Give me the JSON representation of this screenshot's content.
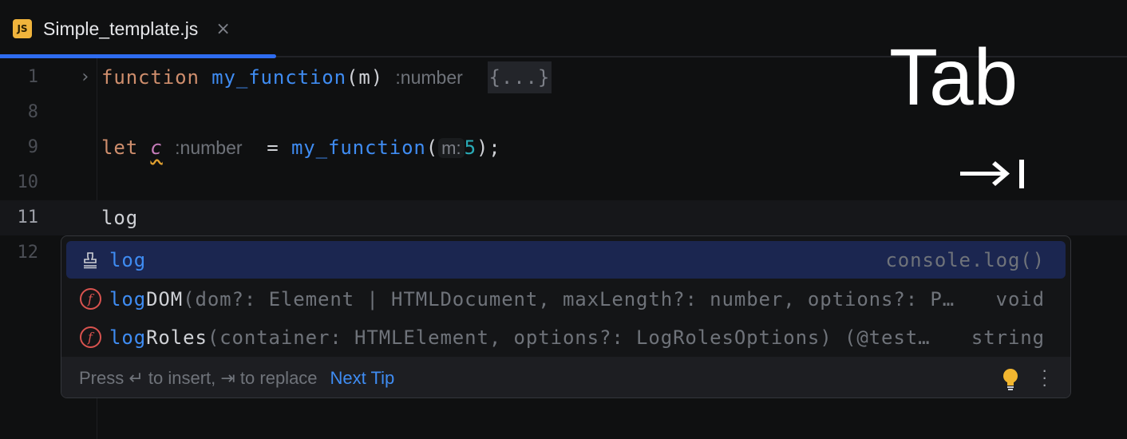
{
  "tab": {
    "icon_label": "JS",
    "title": "Simple_template.js",
    "close": "×"
  },
  "editor": {
    "lines": [
      {
        "number": "1",
        "kw": "function",
        "name": "my_function",
        "params": "(m)",
        "return_hint": ":number",
        "folded": "{...}"
      },
      {
        "number": "8"
      },
      {
        "number": "9",
        "kw": "let",
        "var": "c",
        "type_hint": ":number",
        "eq": " = ",
        "call": "my_function",
        "open": "(",
        "param_hint": "m:",
        "arg": "5",
        "close": ");"
      },
      {
        "number": "10"
      },
      {
        "number": "11",
        "text": "log"
      },
      {
        "number": "12"
      }
    ]
  },
  "completion": {
    "items": [
      {
        "match": "log",
        "rest": "",
        "signature": "",
        "type": "console.log()"
      },
      {
        "match": "log",
        "rest": "DOM",
        "signature": "(dom?: Element | HTMLDocument, maxLength?: number, options?: P…",
        "type": "void"
      },
      {
        "match": "log",
        "rest": "Roles",
        "signature": "(container: HTMLElement, options?: LogRolesOptions) (@test…",
        "type": "string"
      }
    ],
    "footer": {
      "text": "Press ↵ to insert, ⇥ to replace",
      "next_tip": "Next Tip"
    }
  },
  "overlay": {
    "key": "Tab"
  },
  "colors": {
    "accent": "#2e6cf0",
    "keyword": "#cf8e6d",
    "function": "#3f8cf2",
    "selection": "#1b2650"
  }
}
